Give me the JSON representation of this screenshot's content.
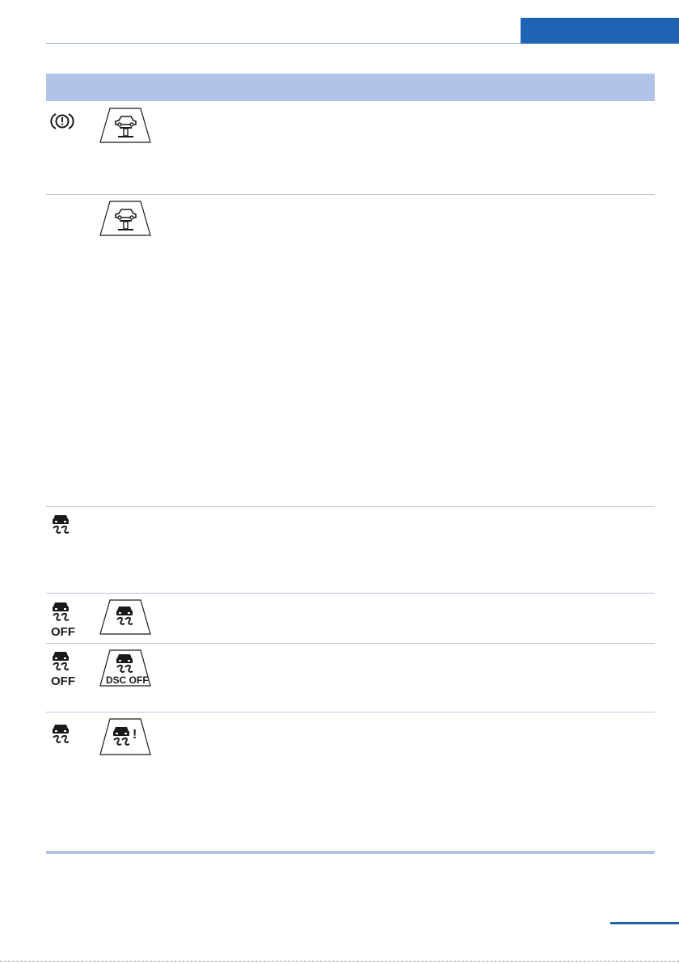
{
  "colors": {
    "accent_blue": "#1f63b5",
    "header_fill": "#b3c3e8",
    "divider": "#b9c6e0",
    "icon": "#1a1a1a"
  },
  "rows": [
    {
      "indicator": "brake-warning-icon",
      "display": "vehicle-lift-display-icon"
    },
    {
      "indicator": "",
      "display": "vehicle-lift-display-icon"
    },
    {
      "indicator": "dsc-icon",
      "display": ""
    },
    {
      "indicator": "dsc-off-icon",
      "display": "dsc-display-icon"
    },
    {
      "indicator": "dsc-off-icon",
      "display": "dsc-off-display-icon"
    },
    {
      "indicator": "dsc-icon",
      "display": "dsc-fault-display-icon"
    }
  ],
  "labels": {
    "off": "OFF",
    "dsc_off": "DSC OFF",
    "fault_mark": "!"
  }
}
